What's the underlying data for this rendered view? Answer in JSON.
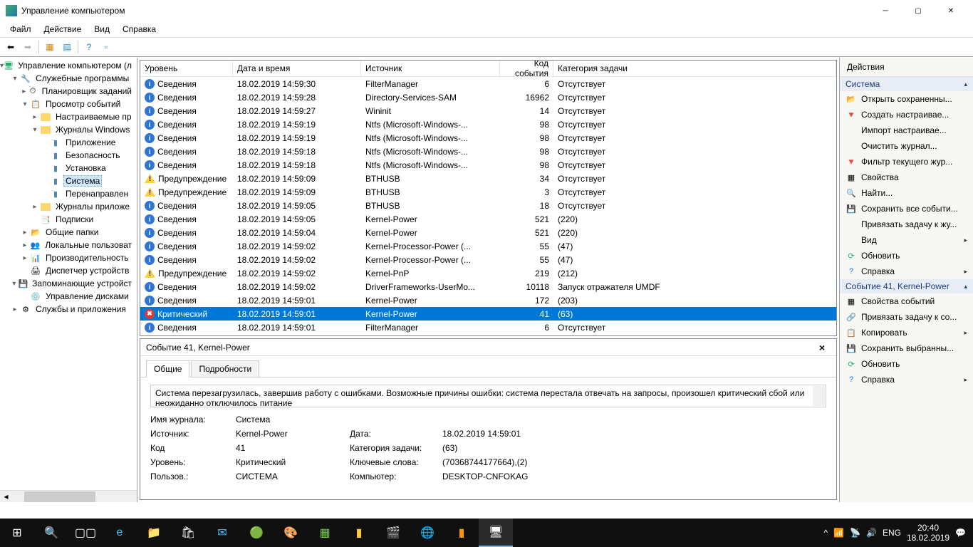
{
  "window": {
    "title": "Управление компьютером"
  },
  "menu": {
    "file": "Файл",
    "action": "Действие",
    "view": "Вид",
    "help": "Справка"
  },
  "tree": {
    "root": "Управление компьютером (л",
    "services": "Служебные программы",
    "scheduler": "Планировщик заданий",
    "eventviewer": "Просмотр событий",
    "customviews": "Настраиваемые пр",
    "winlogs": "Журналы Windows",
    "application": "Приложение",
    "security": "Безопасность",
    "setup": "Установка",
    "system": "Система",
    "forwarded": "Перенаправлен",
    "applogs": "Журналы приложе",
    "subs": "Подписки",
    "shared": "Общие папки",
    "users": "Локальные пользоват",
    "perf": "Производительность",
    "devmgr": "Диспетчер устройств",
    "storage": "Запоминающие устройст",
    "diskmgmt": "Управление дисками",
    "svcapps": "Службы и приложения"
  },
  "columns": {
    "level": "Уровень",
    "datetime": "Дата и время",
    "source": "Источник",
    "eventid": "Код события",
    "category": "Категория задачи"
  },
  "events": [
    {
      "icon": "info",
      "level": "Сведения",
      "dt": "18.02.2019 14:59:30",
      "src": "FilterManager",
      "id": "6",
      "cat": "Отсутствует"
    },
    {
      "icon": "info",
      "level": "Сведения",
      "dt": "18.02.2019 14:59:28",
      "src": "Directory-Services-SAM",
      "id": "16962",
      "cat": "Отсутствует"
    },
    {
      "icon": "info",
      "level": "Сведения",
      "dt": "18.02.2019 14:59:27",
      "src": "Wininit",
      "id": "14",
      "cat": "Отсутствует"
    },
    {
      "icon": "info",
      "level": "Сведения",
      "dt": "18.02.2019 14:59:19",
      "src": "Ntfs (Microsoft-Windows-...",
      "id": "98",
      "cat": "Отсутствует"
    },
    {
      "icon": "info",
      "level": "Сведения",
      "dt": "18.02.2019 14:59:19",
      "src": "Ntfs (Microsoft-Windows-...",
      "id": "98",
      "cat": "Отсутствует"
    },
    {
      "icon": "info",
      "level": "Сведения",
      "dt": "18.02.2019 14:59:18",
      "src": "Ntfs (Microsoft-Windows-...",
      "id": "98",
      "cat": "Отсутствует"
    },
    {
      "icon": "info",
      "level": "Сведения",
      "dt": "18.02.2019 14:59:18",
      "src": "Ntfs (Microsoft-Windows-...",
      "id": "98",
      "cat": "Отсутствует"
    },
    {
      "icon": "warn",
      "level": "Предупреждение",
      "dt": "18.02.2019 14:59:09",
      "src": "BTHUSB",
      "id": "34",
      "cat": "Отсутствует"
    },
    {
      "icon": "warn",
      "level": "Предупреждение",
      "dt": "18.02.2019 14:59:09",
      "src": "BTHUSB",
      "id": "3",
      "cat": "Отсутствует"
    },
    {
      "icon": "info",
      "level": "Сведения",
      "dt": "18.02.2019 14:59:05",
      "src": "BTHUSB",
      "id": "18",
      "cat": "Отсутствует"
    },
    {
      "icon": "info",
      "level": "Сведения",
      "dt": "18.02.2019 14:59:05",
      "src": "Kernel-Power",
      "id": "521",
      "cat": "(220)"
    },
    {
      "icon": "info",
      "level": "Сведения",
      "dt": "18.02.2019 14:59:04",
      "src": "Kernel-Power",
      "id": "521",
      "cat": "(220)"
    },
    {
      "icon": "info",
      "level": "Сведения",
      "dt": "18.02.2019 14:59:02",
      "src": "Kernel-Processor-Power (...",
      "id": "55",
      "cat": "(47)"
    },
    {
      "icon": "info",
      "level": "Сведения",
      "dt": "18.02.2019 14:59:02",
      "src": "Kernel-Processor-Power (...",
      "id": "55",
      "cat": "(47)"
    },
    {
      "icon": "warn",
      "level": "Предупреждение",
      "dt": "18.02.2019 14:59:02",
      "src": "Kernel-PnP",
      "id": "219",
      "cat": "(212)"
    },
    {
      "icon": "info",
      "level": "Сведения",
      "dt": "18.02.2019 14:59:02",
      "src": "DriverFrameworks-UserMo...",
      "id": "10118",
      "cat": "Запуск отражателя UMDF"
    },
    {
      "icon": "info",
      "level": "Сведения",
      "dt": "18.02.2019 14:59:01",
      "src": "Kernel-Power",
      "id": "172",
      "cat": "(203)"
    },
    {
      "icon": "crit",
      "level": "Критический",
      "dt": "18.02.2019 14:59:01",
      "src": "Kernel-Power",
      "id": "41",
      "cat": "(63)",
      "selected": true
    },
    {
      "icon": "info",
      "level": "Сведения",
      "dt": "18.02.2019 14:59:01",
      "src": "FilterManager",
      "id": "6",
      "cat": "Отсутствует"
    }
  ],
  "detail": {
    "title": "Событие 41, Kernel-Power",
    "tab_general": "Общие",
    "tab_details": "Подробности",
    "message": "Система перезагрузилась, завершив работу с ошибками. Возможные причины ошибки: система перестала отвечать на запросы, произошел критический сбой или неожиданно отключилось питание",
    "lbl_logname": "Имя журнала:",
    "val_logname": "Система",
    "lbl_source": "Источник:",
    "val_source": "Kernel-Power",
    "lbl_date": "Дата:",
    "val_date": "18.02.2019 14:59:01",
    "lbl_code": "Код",
    "val_code": "41",
    "lbl_category": "Категория задачи:",
    "val_category": "(63)",
    "lbl_level": "Уровень:",
    "val_level": "Критический",
    "lbl_keywords": "Ключевые слова:",
    "val_keywords": "(70368744177664),(2)",
    "lbl_user": "Пользов.:",
    "val_user": "СИСТЕМА",
    "lbl_computer": "Компьютер:",
    "val_computer": "DESKTOP-CNFOKAG"
  },
  "actions": {
    "title": "Действия",
    "section1": "Система",
    "open_saved": "Открыть сохраненны...",
    "create_custom": "Создать настраивае...",
    "import_custom": "Импорт настраивае...",
    "clear_log": "Очистить журнал...",
    "filter_log": "Фильтр текущего жур...",
    "properties": "Свойства",
    "find": "Найти...",
    "save_all": "Сохранить все событи...",
    "attach_task": "Привязать задачу к жу...",
    "view": "Вид",
    "refresh": "Обновить",
    "help": "Справка",
    "section2": "Событие 41, Kernel-Power",
    "event_props": "Свойства событий",
    "attach_task2": "Привязать задачу к со...",
    "copy": "Копировать",
    "save_selected": "Сохранить выбранны...",
    "refresh2": "Обновить",
    "help2": "Справка"
  },
  "taskbar": {
    "lang": "ENG",
    "time": "20:40",
    "date": "18.02.2019"
  }
}
